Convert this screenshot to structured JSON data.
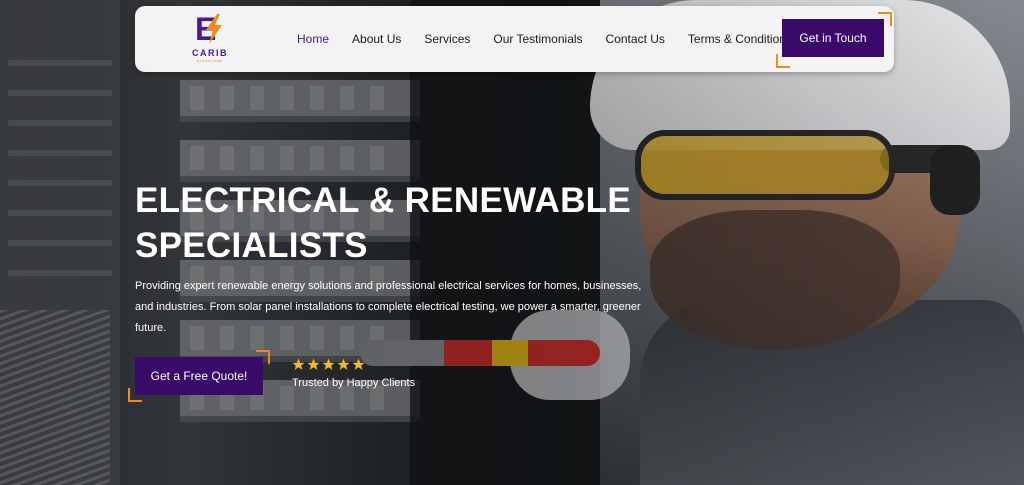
{
  "brand": {
    "name": "CARIB",
    "tagline": "electrical",
    "logo_icon": "bolt-e-logo",
    "colors": {
      "primary": "#3a0a6b",
      "accent": "#f08a1c",
      "logo_purple": "#4a1a8c"
    }
  },
  "nav": {
    "items": [
      {
        "label": "Home",
        "active": true
      },
      {
        "label": "About Us",
        "active": false
      },
      {
        "label": "Services",
        "active": false
      },
      {
        "label": "Our Testimonials",
        "active": false
      },
      {
        "label": "Contact Us",
        "active": false
      },
      {
        "label": "Terms & Conditions",
        "active": false
      }
    ],
    "cta_label": "Get in Touch"
  },
  "hero": {
    "title_line1": "ELECTRICAL & RENEWABLE",
    "title_line2": "SPECIALISTS",
    "description": "Providing expert renewable energy solutions and professional electrical services for homes, businesses, and industries. From solar panel installations to complete electrical testing, we power a smarter, greener future.",
    "quote_button_label": "Get a Free Quote!",
    "rating_stars": 5,
    "rating_icon": "star-icon",
    "trust_text": "Trusted by Happy Clients"
  }
}
